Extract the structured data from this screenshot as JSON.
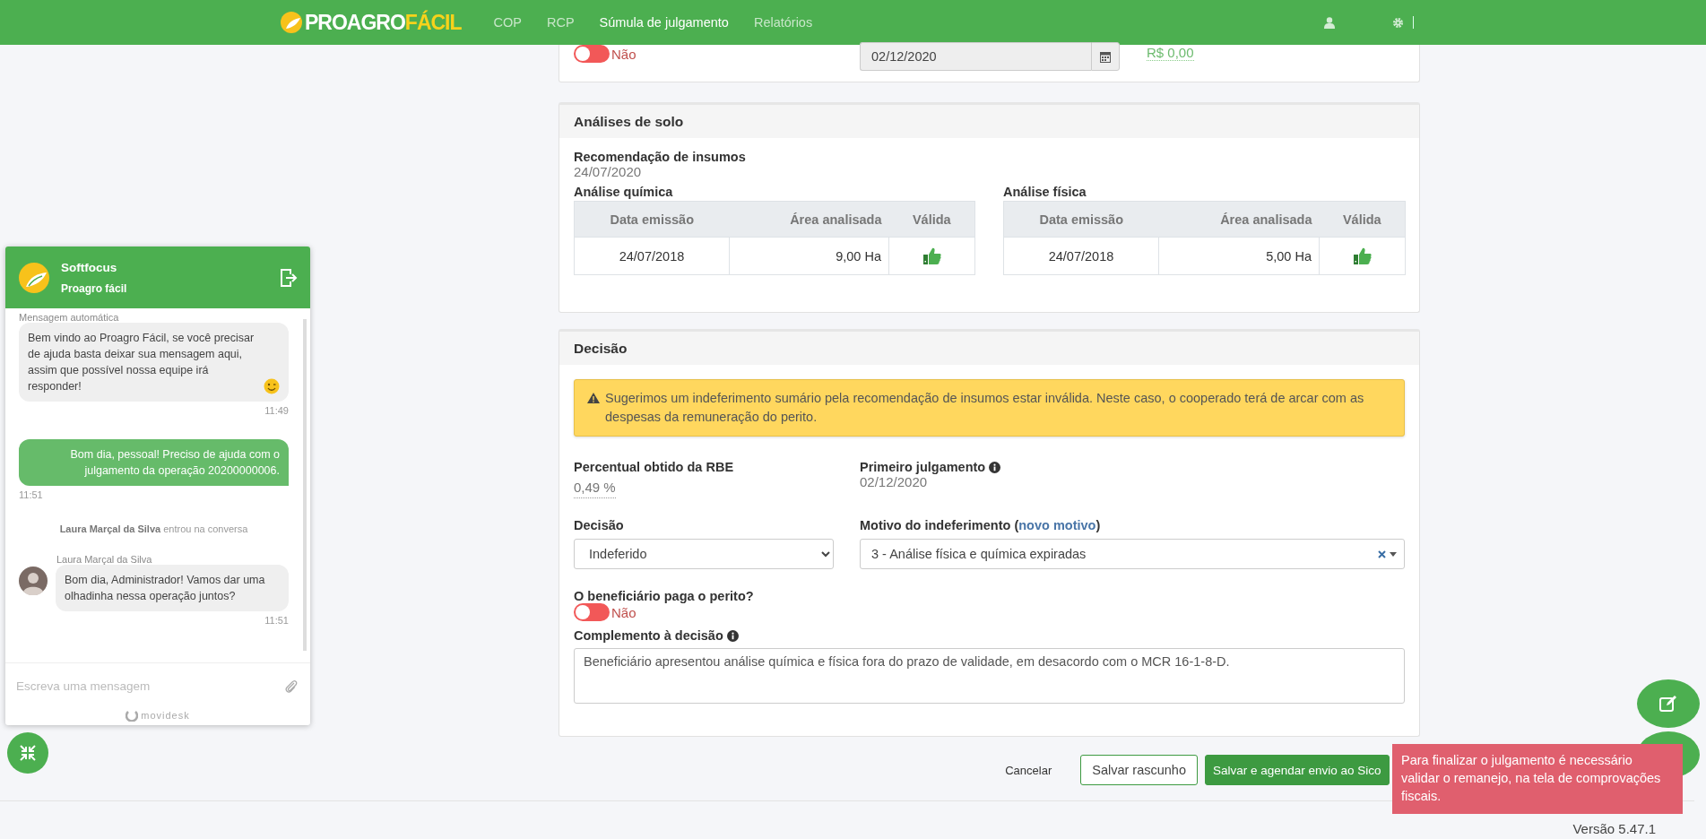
{
  "nav": {
    "brand": {
      "part_1": "PROAGRO",
      "part_2": "FÁCIL"
    },
    "links": [
      {
        "label": "COP",
        "selected": false
      },
      {
        "label": "RCP",
        "selected": false
      },
      {
        "label": "Súmula de julgamento",
        "selected": true
      },
      {
        "label": "Relatórios",
        "selected": false
      }
    ]
  },
  "top_card": {
    "toggle": {
      "on": false,
      "label": "Não"
    },
    "date": "02/12/2020",
    "amount": "R$ 0,00"
  },
  "soil": {
    "title": "Análises de solo",
    "recommendation_label": "Recomendação de insumos",
    "recommendation_date": "24/07/2020",
    "tables": [
      {
        "title": "Análise química",
        "columns": [
          "Data emissão",
          "Área analisada",
          "Válida"
        ],
        "rows": [
          {
            "date": "24/07/2018",
            "area": "9,00 Ha",
            "valid": true
          }
        ]
      },
      {
        "title": "Análise física",
        "columns": [
          "Data emissão",
          "Área analisada",
          "Válida"
        ],
        "rows": [
          {
            "date": "24/07/2018",
            "area": "5,00 Ha",
            "valid": true
          }
        ]
      }
    ]
  },
  "decision": {
    "title": "Decisão",
    "alert": "Sugerimos um indeferimento sumário pela recomendação de insumos estar inválida. Neste caso, o cooperado terá de arcar com as despesas da remuneração do perito.",
    "rbe_label": "Percentual obtido da RBE",
    "rbe_value": "0,49 %",
    "first_label": "Primeiro julgamento",
    "first_value": "02/12/2020",
    "decision_label": "Decisão",
    "decision_value": "Indeferido",
    "reason_label_open": "Motivo do indeferimento (",
    "reason_link": "novo motivo",
    "reason_label_close": ")",
    "reason_value": "3 - Análise física e química expiradas",
    "payer_label": "O beneficiário paga o perito?",
    "payer_toggle": {
      "on": false,
      "label": "Não"
    },
    "complement_label": "Complemento à decisão",
    "complement_value": "Beneficiário apresentou análise química e física fora do prazo de validade, em desacordo com o MCR 16-1-8-D."
  },
  "actions": [
    {
      "label": "Cancelar",
      "kind": "link"
    },
    {
      "label": "Salvar rascunho",
      "kind": "outline"
    },
    {
      "label": "Salvar e agendar envio ao Sico",
      "kind": "primary"
    }
  ],
  "tooltip": "Para finalizar o julgamento é necessário validar o remanejo, na tela de comprovações fiscais.",
  "version": "Versão 5.47.1",
  "chat": {
    "title": "Softfocus",
    "subtitle": "Proagro fácil",
    "messages": [
      {
        "kind": "incoming",
        "sender": "Mensagem automática",
        "avatar": false,
        "text": "Bem vindo ao Proagro Fácil, se você precisar de ajuda basta deixar sua mensagem aqui, assim que possível nossa equipe irá responder!",
        "emoji": true,
        "time": "11:49"
      },
      {
        "kind": "outgoing",
        "text": "Bom dia, pessoal! Preciso de ajuda com o julgamento da operação 20200000006.",
        "time": "11:51"
      },
      {
        "kind": "event",
        "text": "**Laura Marçal da Silva** entrou na conversa"
      },
      {
        "kind": "incoming",
        "sender": "Laura Marçal da Silva",
        "avatar": true,
        "text": "Bom dia, Administrador! Vamos dar uma olhadinha nessa operação juntos?",
        "emoji": false,
        "time": "11:51"
      }
    ],
    "placeholder": "Escreva uma mensagem",
    "powered_by": "movidesk"
  }
}
